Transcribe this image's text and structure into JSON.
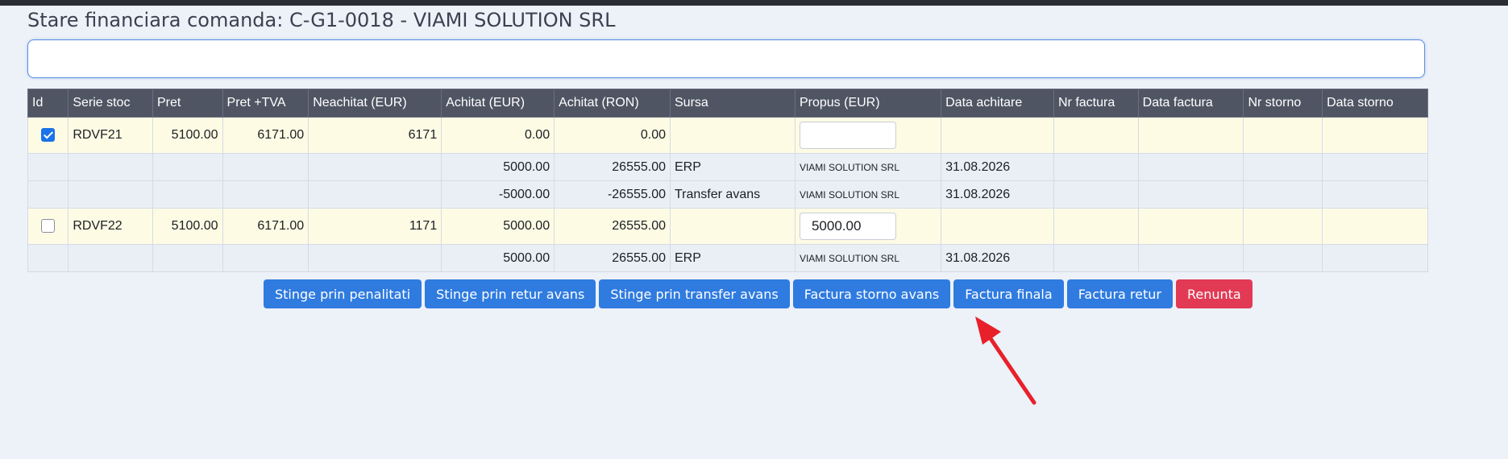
{
  "page": {
    "title": "Stare financiara comanda: C-G1-0018 - VIAMI SOLUTION SRL",
    "search_value": ""
  },
  "table": {
    "headers": [
      "Id",
      "Serie stoc",
      "Pret",
      "Pret +TVA",
      "Neachitat (EUR)",
      "Achitat (EUR)",
      "Achitat (RON)",
      "Sursa",
      "Propus (EUR)",
      "Data achitare",
      "Nr factura",
      "Data factura",
      "Nr storno",
      "Data storno"
    ],
    "rows": [
      {
        "checked": true,
        "serie": "RDVF21",
        "pret": "5100.00",
        "pret_tva": "6171.00",
        "neachitat": "6171",
        "achitat_eur": "0.00",
        "achitat_ron": "0.00",
        "sursa": "",
        "propus": "",
        "data_achitare": "",
        "nr_factura": "",
        "data_factura": "",
        "nr_storno": "",
        "data_storno": ""
      },
      {
        "serie": "",
        "pret": "",
        "pret_tva": "",
        "neachitat": "",
        "achitat_eur": "5000.00",
        "achitat_ron": "26555.00",
        "sursa": "ERP",
        "propus": "VIAMI SOLUTION SRL",
        "data_achitare": "31.08.2026",
        "nr_factura": "",
        "data_factura": "",
        "nr_storno": "",
        "data_storno": ""
      },
      {
        "serie": "",
        "pret": "",
        "pret_tva": "",
        "neachitat": "",
        "achitat_eur": "-5000.00",
        "achitat_ron": "-26555.00",
        "sursa": "Transfer avans",
        "propus": "VIAMI SOLUTION SRL",
        "data_achitare": "31.08.2026",
        "nr_factura": "",
        "data_factura": "",
        "nr_storno": "",
        "data_storno": ""
      },
      {
        "checked": false,
        "serie": "RDVF22",
        "pret": "5100.00",
        "pret_tva": "6171.00",
        "neachitat": "1171",
        "achitat_eur": "5000.00",
        "achitat_ron": "26555.00",
        "sursa": "",
        "propus": "5000.00",
        "data_achitare": "",
        "nr_factura": "",
        "data_factura": "",
        "nr_storno": "",
        "data_storno": ""
      },
      {
        "serie": "",
        "pret": "",
        "pret_tva": "",
        "neachitat": "",
        "achitat_eur": "5000.00",
        "achitat_ron": "26555.00",
        "sursa": "ERP",
        "propus": "VIAMI SOLUTION SRL",
        "data_achitare": "31.08.2026",
        "nr_factura": "",
        "data_factura": "",
        "nr_storno": "",
        "data_storno": ""
      }
    ]
  },
  "actions": {
    "stinge_penalitati": "Stinge prin penalitati",
    "stinge_retur_avans": "Stinge prin retur avans",
    "stinge_transfer_avans": "Stinge prin transfer avans",
    "factura_storno_avans": "Factura storno avans",
    "factura_finala": "Factura finala",
    "factura_retur": "Factura retur",
    "renunta": "Renunta"
  },
  "colors": {
    "primary": "#2f7be0",
    "danger": "#e23a55",
    "header_bg": "#4f5563",
    "main_row_bg": "#fdfbe4",
    "sub_row_bg": "#eaeff6",
    "annotation_arrow": "#e8202a"
  },
  "icons": {
    "checkbox_checked": "check-icon",
    "annotation": "red-arrow-icon"
  }
}
